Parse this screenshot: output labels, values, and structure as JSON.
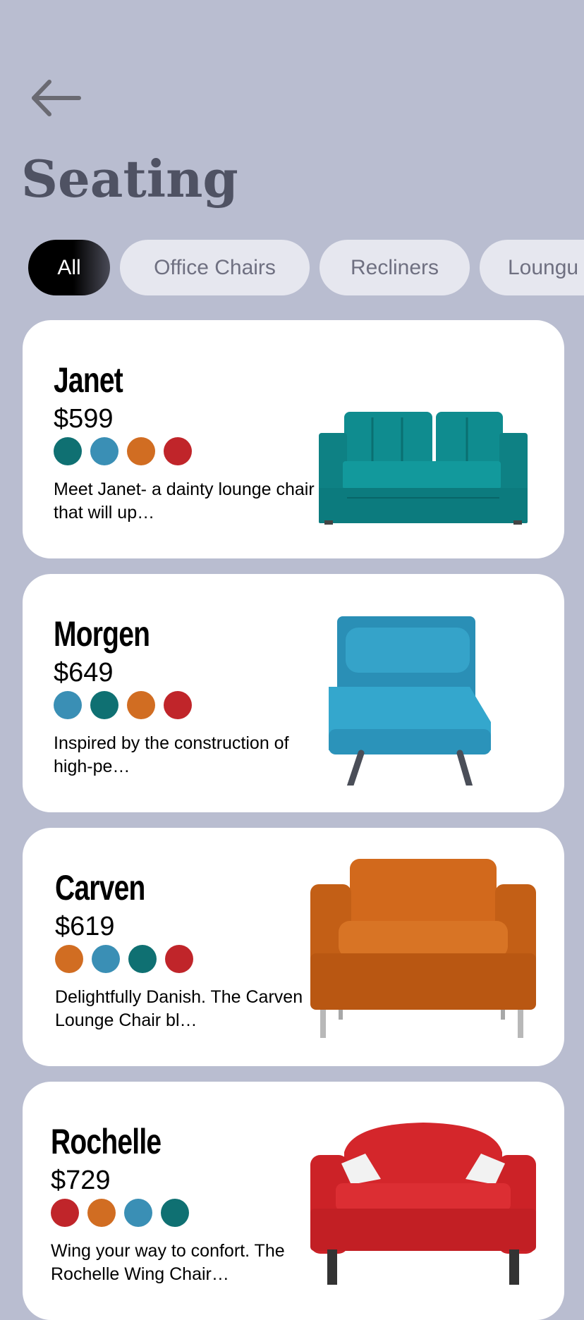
{
  "page": {
    "title": "Seating",
    "back_icon": "arrow-left-icon"
  },
  "filters": [
    {
      "label": "All",
      "active": true
    },
    {
      "label": "Office Chairs",
      "active": false
    },
    {
      "label": "Recliners",
      "active": false
    },
    {
      "label": "Loungu",
      "active": false
    }
  ],
  "colors": {
    "background": "#b9bdd0",
    "title": "#4f5263",
    "teal": "#0f7072",
    "blue": "#3a8fb5",
    "orange": "#d16d22",
    "red": "#c0252a"
  },
  "products": [
    {
      "name": "Janet",
      "price": "$599",
      "swatches": [
        "#0f7072",
        "#3a8fb5",
        "#d16d22",
        "#c0252a"
      ],
      "description": "Meet Janet- a dainty lounge chair that will up…",
      "image": "teal-loveseat-sofa"
    },
    {
      "name": "Morgen",
      "price": "$649",
      "swatches": [
        "#3a8fb5",
        "#0f7072",
        "#d16d22",
        "#c0252a"
      ],
      "description": "Inspired by the construction of high-pe…",
      "image": "blue-sleeper-chair"
    },
    {
      "name": "Carven",
      "price": "$619",
      "swatches": [
        "#d16d22",
        "#3a8fb5",
        "#0f7072",
        "#c0252a"
      ],
      "description": "Delightfully Danish. The Carven Lounge Chair bl…",
      "image": "orange-lounge-armchair"
    },
    {
      "name": "Rochelle",
      "price": "$729",
      "swatches": [
        "#c0252a",
        "#d16d22",
        "#3a8fb5",
        "#0f7072"
      ],
      "description": "Wing your way to confort. The Rochelle Wing Chair…",
      "image": "red-wing-chair"
    }
  ]
}
